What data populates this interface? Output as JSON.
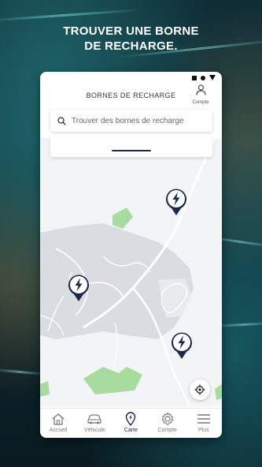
{
  "headline": {
    "line1": "TROUVER UNE BORNE",
    "line2": "DE RECHARGE."
  },
  "app": {
    "title": "BORNES DE RECHARGE",
    "account_label": "Compte",
    "search": {
      "placeholder": "Trouver des bornes de recharge",
      "value": ""
    }
  },
  "tabs": [
    {
      "label": "Accueil",
      "icon": "home-icon",
      "active": false
    },
    {
      "label": "Véhicule",
      "icon": "car-icon",
      "active": false
    },
    {
      "label": "Carte",
      "icon": "map-pin-icon",
      "active": true
    },
    {
      "label": "Compte",
      "icon": "gear-icon",
      "active": false
    },
    {
      "label": "Plus",
      "icon": "menu-icon",
      "active": false
    }
  ],
  "map": {
    "marker_count": 3,
    "marker_icon": "lightning-bolt-icon"
  },
  "colors": {
    "accent_navy": "#1b2a4a",
    "map_green": "#a8dba0",
    "map_gray": "#d9dde2"
  }
}
